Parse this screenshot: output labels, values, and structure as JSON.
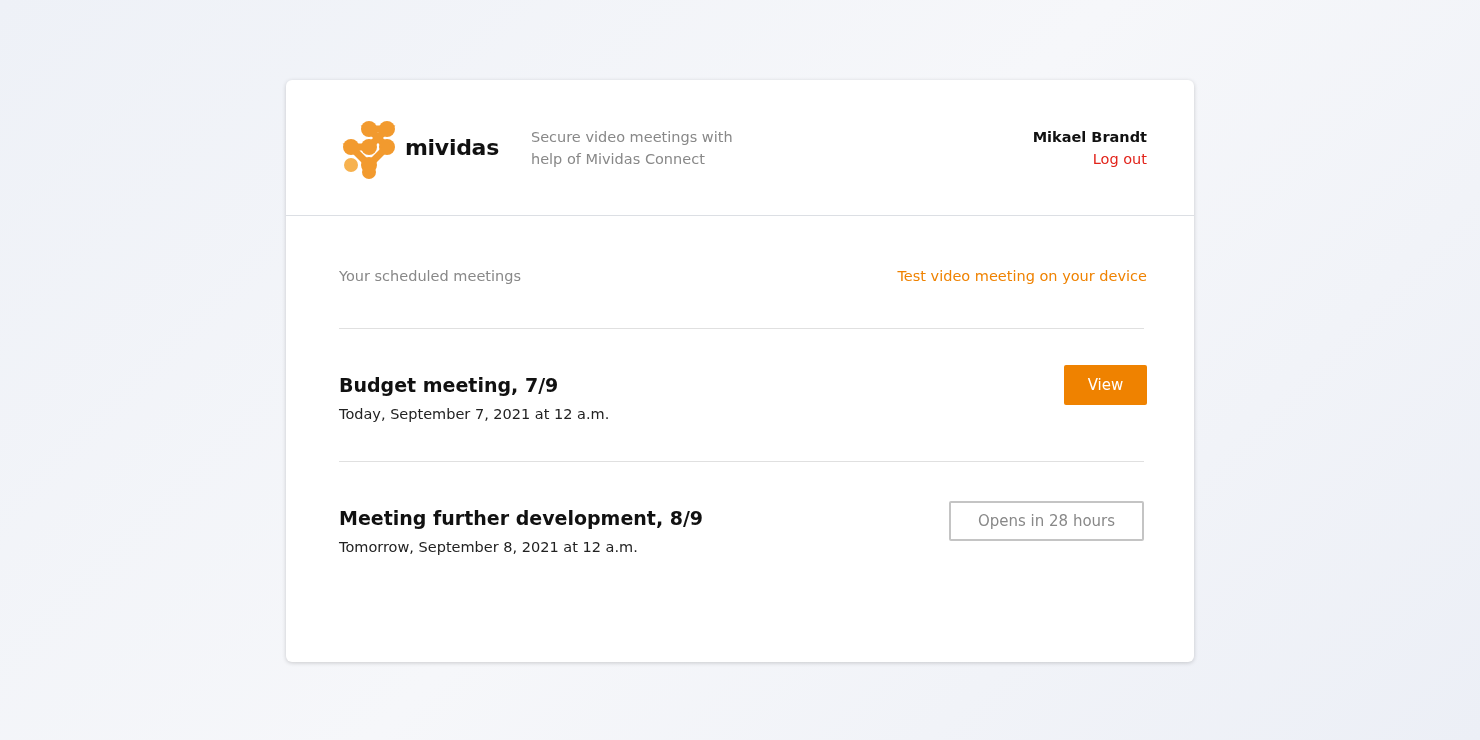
{
  "header": {
    "logo_text": "mividas",
    "tagline": "Secure video meetings with help of Mividas Connect",
    "user_name": "Mikael Brandt",
    "logout": "Log out"
  },
  "section": {
    "title": "Your scheduled meetings",
    "test_link": "Test video meeting on your device"
  },
  "meetings": [
    {
      "title": "Budget meeting, 7/9",
      "when": "Today, September 7, 2021 at 12 a.m.",
      "action": "View",
      "disabled": false
    },
    {
      "title": "Meeting further development, 8/9",
      "when": "Tomorrow, September 8, 2021 at 12 a.m.",
      "action": "Opens in 28 hours",
      "disabled": true
    }
  ]
}
